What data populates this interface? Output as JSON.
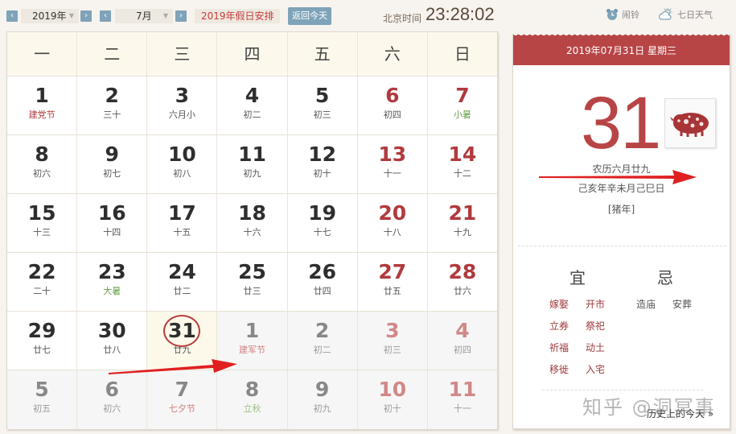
{
  "toolbar": {
    "prev_year": "‹",
    "year": "2019年",
    "next_year": "›",
    "prev_month": "‹",
    "month": "7月",
    "next_month": "›",
    "holiday_select": "2019年假日安排",
    "today_button": "返回今天",
    "clock_label": "北京时间",
    "clock_time": "23:28:02",
    "alarm_label": "闹铃",
    "weather_label": "七日天气"
  },
  "weekdays": [
    "一",
    "二",
    "三",
    "四",
    "五",
    "六",
    "日"
  ],
  "weeks": [
    [
      {
        "day": "1",
        "lunar": "建党节",
        "type": "fest"
      },
      {
        "day": "2",
        "lunar": "三十",
        "type": ""
      },
      {
        "day": "3",
        "lunar": "六月小",
        "type": ""
      },
      {
        "day": "4",
        "lunar": "初二",
        "type": ""
      },
      {
        "day": "5",
        "lunar": "初三",
        "type": ""
      },
      {
        "day": "6",
        "lunar": "初四",
        "type": "weekend"
      },
      {
        "day": "7",
        "lunar": "小暑",
        "type": "weekend term"
      }
    ],
    [
      {
        "day": "8",
        "lunar": "初六",
        "type": ""
      },
      {
        "day": "9",
        "lunar": "初七",
        "type": ""
      },
      {
        "day": "10",
        "lunar": "初八",
        "type": ""
      },
      {
        "day": "11",
        "lunar": "初九",
        "type": ""
      },
      {
        "day": "12",
        "lunar": "初十",
        "type": ""
      },
      {
        "day": "13",
        "lunar": "十一",
        "type": "weekend"
      },
      {
        "day": "14",
        "lunar": "十二",
        "type": "weekend"
      }
    ],
    [
      {
        "day": "15",
        "lunar": "十三",
        "type": ""
      },
      {
        "day": "16",
        "lunar": "十四",
        "type": ""
      },
      {
        "day": "17",
        "lunar": "十五",
        "type": ""
      },
      {
        "day": "18",
        "lunar": "十六",
        "type": ""
      },
      {
        "day": "19",
        "lunar": "十七",
        "type": ""
      },
      {
        "day": "20",
        "lunar": "十八",
        "type": "weekend"
      },
      {
        "day": "21",
        "lunar": "十九",
        "type": "weekend"
      }
    ],
    [
      {
        "day": "22",
        "lunar": "二十",
        "type": ""
      },
      {
        "day": "23",
        "lunar": "大暑",
        "type": "term"
      },
      {
        "day": "24",
        "lunar": "廿二",
        "type": ""
      },
      {
        "day": "25",
        "lunar": "廿三",
        "type": ""
      },
      {
        "day": "26",
        "lunar": "廿四",
        "type": ""
      },
      {
        "day": "27",
        "lunar": "廿五",
        "type": "weekend"
      },
      {
        "day": "28",
        "lunar": "廿六",
        "type": "weekend"
      }
    ],
    [
      {
        "day": "29",
        "lunar": "廿七",
        "type": ""
      },
      {
        "day": "30",
        "lunar": "廿八",
        "type": ""
      },
      {
        "day": "31",
        "lunar": "廿九",
        "type": "today"
      },
      {
        "day": "1",
        "lunar": "建军节",
        "type": "other fest"
      },
      {
        "day": "2",
        "lunar": "初二",
        "type": "other"
      },
      {
        "day": "3",
        "lunar": "初三",
        "type": "other weekend"
      },
      {
        "day": "4",
        "lunar": "初四",
        "type": "other weekend"
      }
    ],
    [
      {
        "day": "5",
        "lunar": "初五",
        "type": "other"
      },
      {
        "day": "6",
        "lunar": "初六",
        "type": "other"
      },
      {
        "day": "7",
        "lunar": "七夕节",
        "type": "other fest"
      },
      {
        "day": "8",
        "lunar": "立秋",
        "type": "other term"
      },
      {
        "day": "9",
        "lunar": "初九",
        "type": "other"
      },
      {
        "day": "10",
        "lunar": "初十",
        "type": "other weekend"
      },
      {
        "day": "11",
        "lunar": "十一",
        "type": "other weekend"
      }
    ]
  ],
  "detail": {
    "header": "2019年07月31日 星期三",
    "big_day": "31",
    "zodiac_icon": "pig-papercut-icon",
    "lunar_date": "农历六月廿九",
    "ganzhi": "己亥年辛未月己巳日",
    "zodiac": "[猪年]",
    "yi_title": "宜",
    "ji_title": "忌",
    "yi": [
      "嫁娶",
      "开市",
      "立券",
      "祭祀",
      "祈福",
      "动土",
      "移徙",
      "入宅"
    ],
    "ji": [
      "造庙",
      "安葬"
    ],
    "history_link": "历史上的今天 »",
    "watermark": "知乎 @洞冥事"
  },
  "colors": {
    "accent_red": "#b84546",
    "weekend_red": "#b03a3e",
    "solar_term_green": "#6aa04a",
    "nav_blue": "#7fa3b8",
    "header_cream": "#fcf9ec",
    "annotation_red": "#e02020"
  }
}
